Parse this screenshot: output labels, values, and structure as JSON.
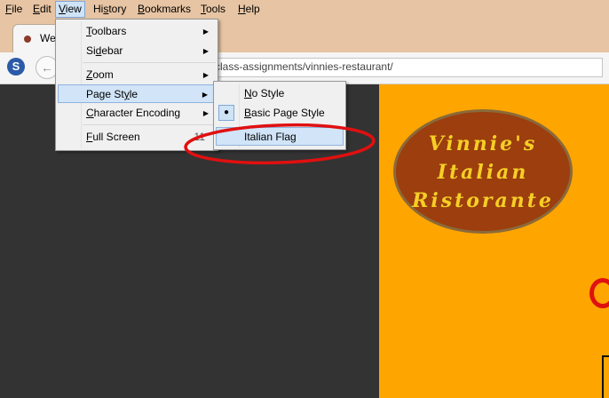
{
  "menubar": {
    "items": [
      {
        "label": "File",
        "accel": "F",
        "rest": "ile"
      },
      {
        "label": "Edit",
        "accel": "E",
        "rest": "dit"
      },
      {
        "label": "View",
        "accel": "V",
        "rest": "iew"
      },
      {
        "label": "History",
        "accel": "s",
        "pre": "Hi",
        "rest": "tory"
      },
      {
        "label": "Bookmarks",
        "accel": "B",
        "rest": "ookmarks"
      },
      {
        "label": "Tools",
        "accel": "T",
        "rest": "ools"
      },
      {
        "label": "Help",
        "accel": "H",
        "rest": "elp"
      }
    ]
  },
  "tab": {
    "title": "We"
  },
  "navbar": {
    "url": "class-assignments/vinnies-restaurant/"
  },
  "view_menu": {
    "items": [
      {
        "accel": "T",
        "rest": "oolbars",
        "has_submenu": true
      },
      {
        "pre": "Si",
        "accel": "d",
        "rest": "ebar",
        "has_submenu": true
      },
      {
        "accel": "Z",
        "rest": "oom",
        "has_submenu": true
      },
      {
        "pre": "Page St",
        "accel": "y",
        "rest": "le",
        "has_submenu": true
      },
      {
        "accel": "C",
        "rest": "haracter Encoding",
        "has_submenu": true
      },
      {
        "accel": "F",
        "rest": "ull Screen",
        "shortcut": "11"
      }
    ]
  },
  "page_style_menu": {
    "items": [
      {
        "accel": "N",
        "rest": "o Style",
        "checked": false
      },
      {
        "accel": "B",
        "rest": "asic Page Style",
        "checked": true
      },
      {
        "label": "Italian Flag",
        "checked": false
      }
    ]
  },
  "page": {
    "logo_lines": [
      "Vinnie's",
      "Italian",
      "Ristorante"
    ]
  },
  "colors": {
    "menubar_bg": "#e7c4a3",
    "page_bg": "#ffa500",
    "logo_bg": "#9c3e0e",
    "logo_text": "#f5cf25",
    "annotation": "#e01010",
    "highlight": "#d1e4f8"
  },
  "icons": {
    "tab_favicon": "favicon-icon",
    "s_icon": "s-logo-icon",
    "back": "back-arrow-icon",
    "submenu": "submenu-arrow-icon",
    "radio": "radio-bullet-icon"
  }
}
